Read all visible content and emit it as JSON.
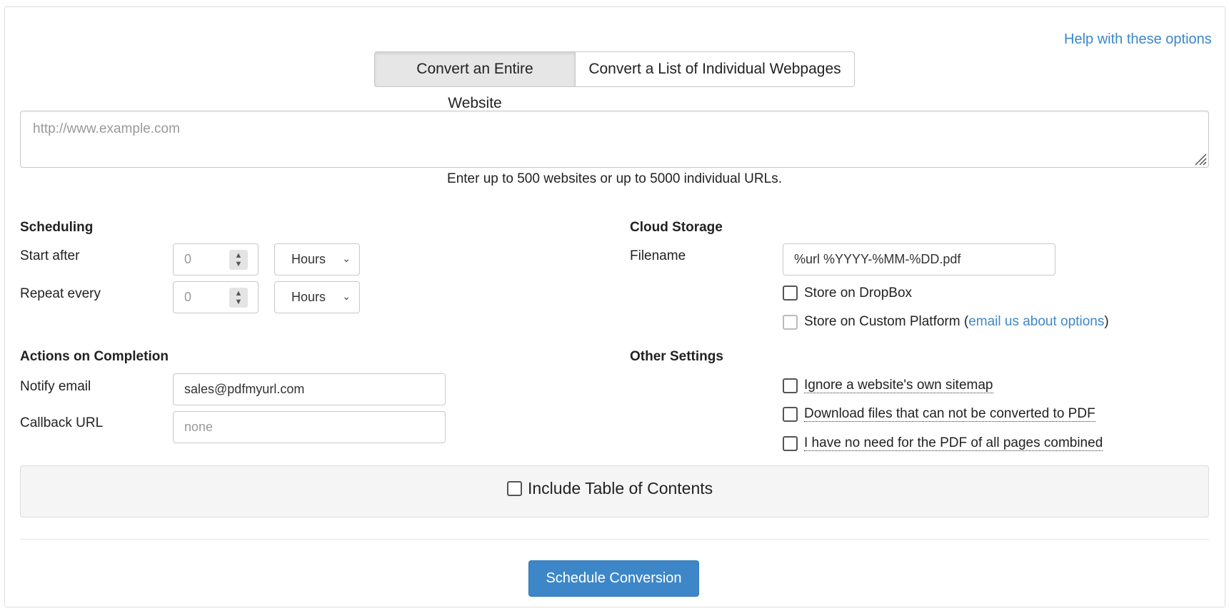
{
  "help_link": "Help with these options",
  "mode_tabs": {
    "entire_website": "Convert an Entire Website",
    "individual_pages": "Convert a List of Individual Webpages"
  },
  "url_input": {
    "placeholder": "http://www.example.com"
  },
  "hint": "Enter up to 500 websites or up to 5000 individual URLs.",
  "scheduling": {
    "heading": "Scheduling",
    "start_after": {
      "label": "Start after",
      "value": "0",
      "unit": "Hours"
    },
    "repeat_every": {
      "label": "Repeat every",
      "value": "0",
      "unit": "Hours"
    }
  },
  "actions": {
    "heading": "Actions on Completion",
    "notify_email": {
      "label": "Notify email",
      "value": "sales@pdfmyurl.com"
    },
    "callback_url": {
      "label": "Callback URL",
      "placeholder": "none"
    }
  },
  "cloud_storage": {
    "heading": "Cloud Storage",
    "filename": {
      "label": "Filename",
      "value": "%url %YYYY-%MM-%DD.pdf"
    },
    "dropbox": {
      "label": "Store on DropBox",
      "checked": false
    },
    "custom_platform": {
      "label_before": "Store on Custom Platform (",
      "link": "email us about options",
      "label_after": ")",
      "checked": false
    }
  },
  "other_settings": {
    "heading": "Other Settings",
    "ignore_sitemap": "Ignore a website's own sitemap",
    "download_files": "Download files that can not be converted to PDF",
    "no_combined_pdf": "I have no need for the PDF of all pages combined"
  },
  "toc": {
    "label": "Include Table of Contents",
    "checked": false
  },
  "submit_label": "Schedule Conversion",
  "colors": {
    "accent": "#3d87c9",
    "panel_bg": "#f5f5f5",
    "border": "#c8c8c8"
  }
}
